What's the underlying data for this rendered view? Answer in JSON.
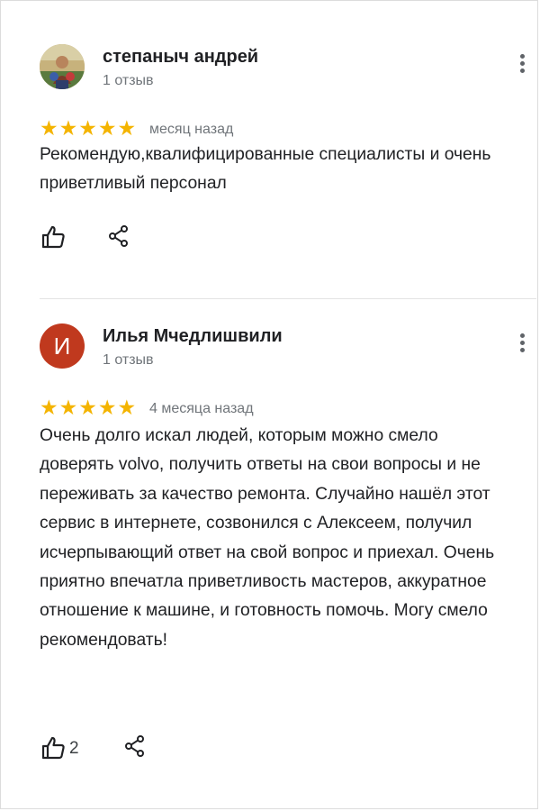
{
  "reviews": [
    {
      "author": "степаныч андрей",
      "review_count": "1 отзыв",
      "avatar_type": "photo",
      "rating": 5,
      "stars": "★★★★★",
      "date": "месяц назад",
      "text": "Рекомендую,квалифицированные специалисты и очень приветливый персонал",
      "likes": "",
      "icons": [
        "thumbs-up-icon",
        "share-icon",
        "more-vert-icon"
      ]
    },
    {
      "author": "Илья Мчедлишвили",
      "review_count": "1 отзыв",
      "avatar_type": "letter",
      "avatar_letter": "И",
      "avatar_color": "#c0391e",
      "rating": 5,
      "stars": "★★★★★",
      "date": "4 месяца назад",
      "text": "Очень долго искал людей, которым можно смело доверять volvo, получить ответы на свои вопросы и не переживать за качество ремонта. Случайно нашёл этот сервис в интернете, созвонился с Алексеем, получил исчерпывающий ответ на свой вопрос и приехал. Очень приятно впечатла приветливость мастеров, аккуратное отношение к машине, и готовность помочь. Могу смело рекомендовать!",
      "likes": "2",
      "icons": [
        "thumbs-up-icon",
        "share-icon",
        "more-vert-icon"
      ]
    }
  ],
  "colors": {
    "star": "#f4b400",
    "secondary_text": "#70757a",
    "icon": "#202124"
  }
}
